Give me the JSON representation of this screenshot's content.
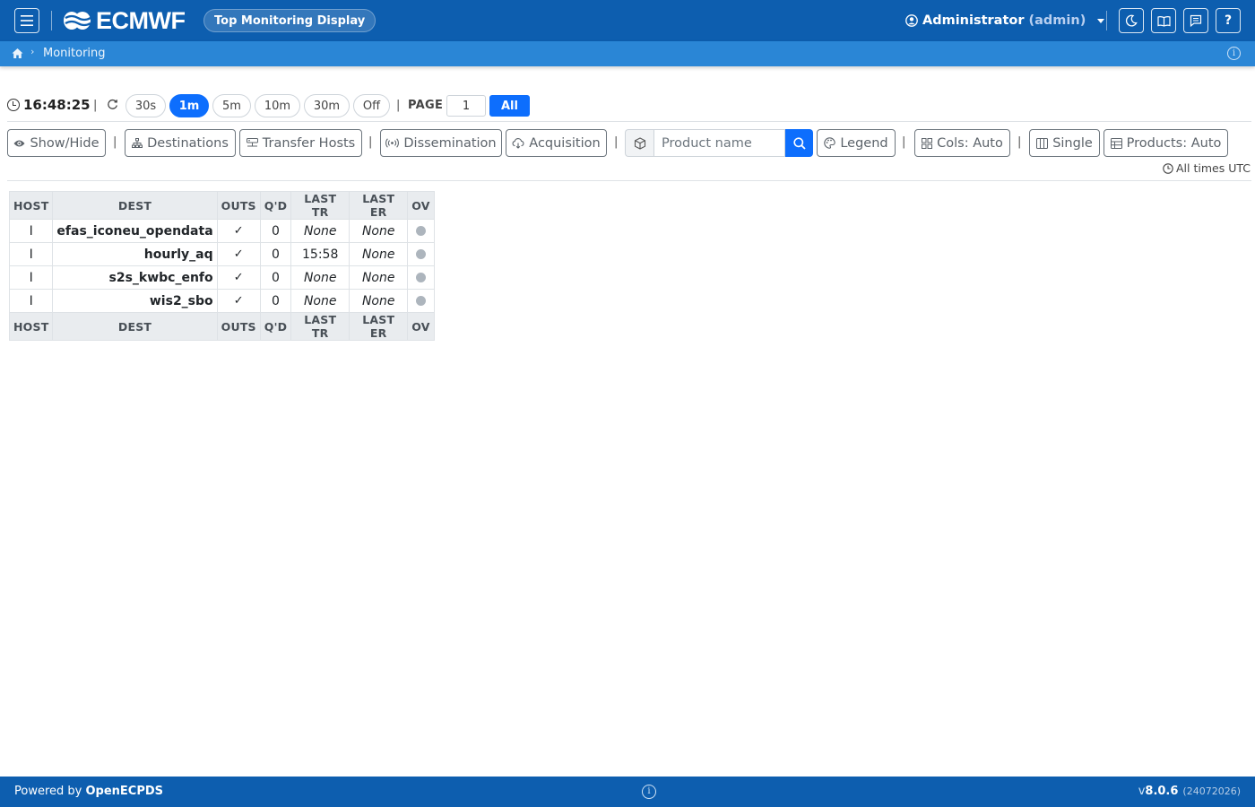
{
  "header": {
    "brand": "ECMWF",
    "app_name": "Top Monitoring Display",
    "user_name": "Administrator",
    "user_role": "(admin)",
    "help_label": "?"
  },
  "breadcrumb": {
    "items": [
      "Monitoring"
    ]
  },
  "controls": {
    "time": "16:48:25",
    "refresh_options": [
      "30s",
      "1m",
      "5m",
      "10m",
      "30m",
      "Off"
    ],
    "refresh_selected": "1m",
    "page_label": "PAGE",
    "page_value": "1",
    "all_label": "All"
  },
  "toolbar": {
    "show_hide": "Show/Hide",
    "destinations": "Destinations",
    "transfer_hosts": "Transfer Hosts",
    "dissemination": "Dissemination",
    "acquisition": "Acquisition",
    "product_placeholder": "Product name",
    "legend": "Legend",
    "cols": "Cols: Auto",
    "single": "Single",
    "products": "Products: Auto",
    "times_note": "All times UTC"
  },
  "table": {
    "columns": [
      "HOST",
      "DEST",
      "OUTS",
      "Q'D",
      "LAST TR",
      "LAST ER",
      "OV"
    ],
    "rows": [
      {
        "host": "I",
        "dest": "efas_iconeu_opendata",
        "outs": "✓",
        "queued": "0",
        "last_tr": "None",
        "last_er": "None"
      },
      {
        "host": "I",
        "dest": "hourly_aq",
        "outs": "✓",
        "queued": "0",
        "last_tr": "15:58",
        "last_er": "None"
      },
      {
        "host": "I",
        "dest": "s2s_kwbc_enfo",
        "outs": "✓",
        "queued": "0",
        "last_tr": "None",
        "last_er": "None"
      },
      {
        "host": "I",
        "dest": "wis2_sbo",
        "outs": "✓",
        "queued": "0",
        "last_tr": "None",
        "last_er": "None"
      }
    ]
  },
  "footer": {
    "powered_by": "Powered by ",
    "product": "OpenECPDS",
    "version_prefix": "v",
    "version": "8.0.6",
    "build": "(24072026)"
  },
  "colors": {
    "navbar": "#0d5eaf",
    "crumbbar": "#2a86d6",
    "accent": "#0d6efd",
    "ok": "#198754",
    "status_dot": "#adb5bd"
  }
}
